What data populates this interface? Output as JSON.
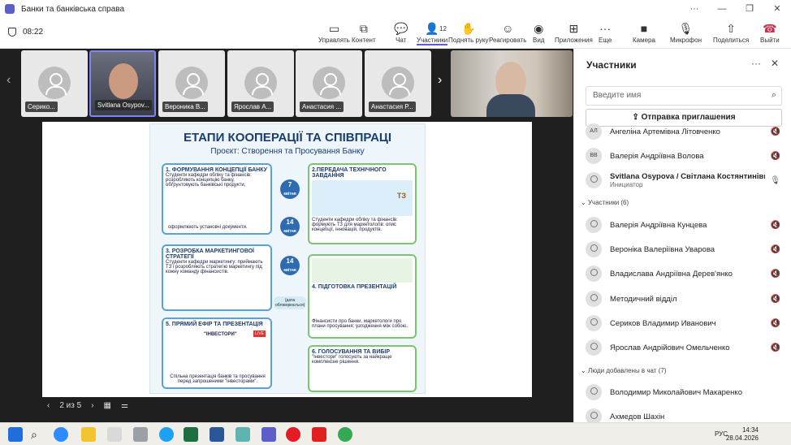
{
  "window": {
    "title": "Банки та банківська справа"
  },
  "toolbar": {
    "timer": "08:22",
    "participants_count": "12",
    "buttons": {
      "layout": "Управлять",
      "content": "Контент",
      "chat": "Чат",
      "people": "Участники",
      "raise": "Поднять руку",
      "react": "Реагировать",
      "view": "Вид",
      "apps": "Приложения",
      "more": "Еще",
      "camera": "Камера",
      "mic": "Микрофон",
      "share": "Поделиться",
      "leave": "Выйти"
    }
  },
  "gallery": {
    "tiles": [
      "Серико...",
      "Svitlana Osypov...",
      "Вероника В...",
      "Ярослав А...",
      "Анастасия ...",
      "Анастасия Р..."
    ]
  },
  "slide": {
    "page_number": "2",
    "title": "ЕТАПИ КООПЕРАЦІЇ ТА СПІВПРАЦІ",
    "subtitle": "Проєкт: Створення та Просування Банку",
    "steps": [
      {
        "title": "1. ФОРМУВАННЯ КОНЦЕПЦІЇ БАНКУ",
        "text": "Студенти кафедри обліку та фінансів: розробляють концепцію банку, обґрунтовують банківські продукти,",
        "footer": "оформлюють установчі документи."
      },
      {
        "title": "2.ПЕРЕДАЧА ТЕХНІЧНОГО ЗАВДАННЯ",
        "text": "Студенти кафедри обліку та фінансів: формують ТЗ для маркетологів: опис концепції, інновацій, продуктів."
      },
      {
        "title": "3. РОЗРОБКА МАРКЕТИНГОВОЇ СТРАТЕГІЇ",
        "text": "Студенти кафедри маркетингу: приймають ТЗ і розробляють стратегію маркетингу під кожну команду фінансистів."
      },
      {
        "title": "4. ПІДГОТОВКА ПРЕЗЕНТАЦІЙ",
        "text": "Фінансисти про банки, маркетологи про плани просування; узгодження між собою."
      },
      {
        "title": "5. ПРЯМИЙ ЕФІР ТА ПРЕЗЕНТАЦІЯ",
        "text": "Спільна презентація банків та просування перед запрошеними \"інвесторами\"."
      },
      {
        "title": "6. ГОЛОСУВАННЯ ТА ВИБІР",
        "text": "\"Інвестори\" голосують за найкраще комплексне рішення."
      }
    ],
    "dates": [
      {
        "num": "7",
        "month": "квітня"
      },
      {
        "num": "14",
        "month": "квітня"
      },
      {
        "num": "14",
        "month": "квітня"
      }
    ],
    "misc": {
      "tz": "ТЗ",
      "investors": "\"ІНВЕСТОРИ\"",
      "live": "LIVE",
      "discuss": "(дата обговорюється)"
    }
  },
  "pagenav": {
    "label": "2 из 5"
  },
  "panel": {
    "title": "Участники",
    "search_placeholder": "Введите имя",
    "invite": "Отправка приглашения",
    "top": [
      {
        "initials": "АЛ",
        "name": "Ангеліна Артемівна Літовченко"
      },
      {
        "initials": "ВВ",
        "name": "Валерія Андріївна Волова"
      },
      {
        "initials": "",
        "name": "Svitlana Osypova / Світлана Костянтинівна...",
        "role": "Инициатор"
      }
    ],
    "section1": "Участники (6)",
    "attendees": [
      "Валерія Андріївна Кунцева",
      "Вероніка Валеріївна Уварова",
      "Владислава Андріївна Дерев'янко",
      "Методичний відділ",
      "Сериков Владимир Иванович",
      "Ярослав Андрійович Омельченко"
    ],
    "section2": "Люди добавлены в чат (7)",
    "chat": [
      "Володимир Миколайович Макаренко",
      "Ахмедов Шахін"
    ]
  },
  "taskbar": {
    "lang": "РУС",
    "time": "14:34",
    "date": "28.04.2026"
  },
  "colors": {
    "accent": "#5b5fc7",
    "leave": "#c4314b",
    "dark": "#1f1f1f"
  }
}
